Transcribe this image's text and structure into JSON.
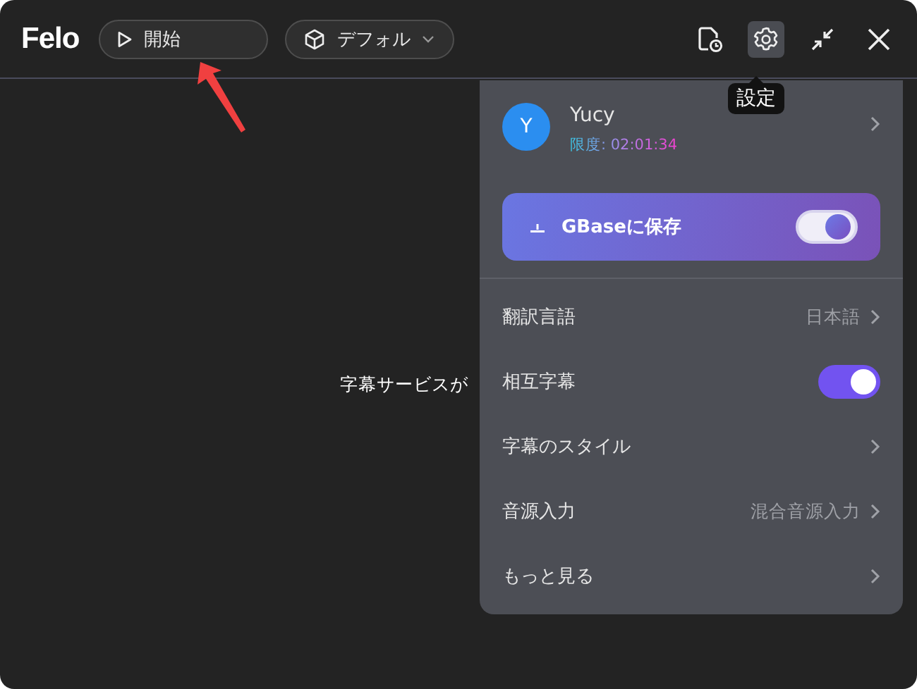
{
  "app": {
    "logo": "Felo"
  },
  "start_button": {
    "label": "開始"
  },
  "model_dropdown": {
    "label": "デフォル"
  },
  "toolbar": [
    {
      "kind": "history",
      "selected": false
    },
    {
      "kind": "settings",
      "selected": true,
      "tooltip": "設定"
    },
    {
      "kind": "collapse",
      "selected": false
    },
    {
      "kind": "close",
      "selected": false
    }
  ],
  "content": {
    "message": "字幕サービスが"
  },
  "settings_panel": {
    "user": {
      "avatar": "Y",
      "name": "Yucy",
      "quota": "限度: 02:01:34"
    },
    "save_card": {
      "label": "GBaseに保存",
      "on": true
    },
    "items": [
      {
        "kind": "link",
        "label": "翻訳言語",
        "value": "日本語"
      },
      {
        "kind": "toggle",
        "label": "相互字幕",
        "on": true
      },
      {
        "kind": "link",
        "label": "字幕のスタイル"
      },
      {
        "kind": "link",
        "label": "音源入力",
        "value": "混合音源入力"
      },
      {
        "kind": "link",
        "label": "もっと見る"
      }
    ]
  }
}
